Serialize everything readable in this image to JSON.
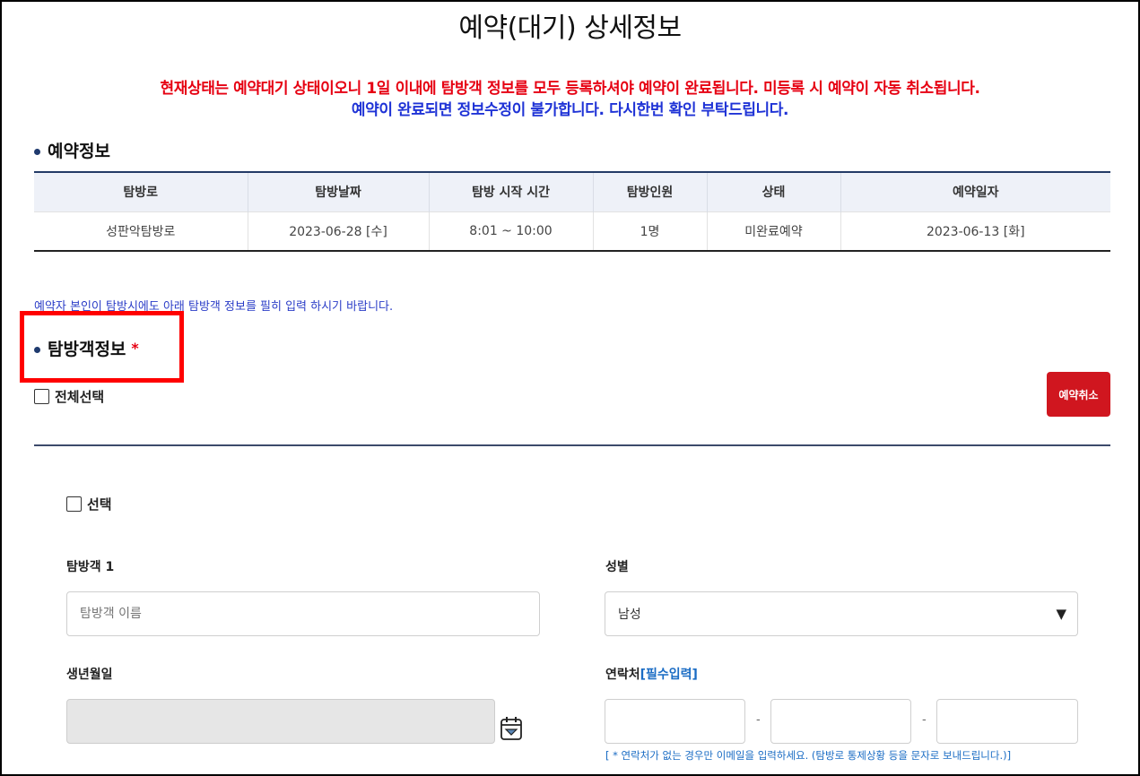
{
  "page": {
    "title": "예약(대기) 상세정보",
    "notice_red": "현재상태는 예약대기 상태이오니 1일 이내에 탐방객 정보를 모두 등록하셔야 예약이 완료됩니다. 미등록 시 예약이 자동 취소됩니다.",
    "notice_blue": "예약이 완료되면 정보수정이 불가합니다. 다시한번 확인 부탁드립니다."
  },
  "reservation": {
    "section_title": "예약정보",
    "headers": [
      "탐방로",
      "탐방날짜",
      "탐방 시작 시간",
      "탐방인원",
      "상태",
      "예약일자"
    ],
    "row": [
      "성판악탐방로",
      "2023-06-28 [수]",
      "8:01 ~ 10:00",
      "1명",
      "미완료예약",
      "2023-06-13 [화]"
    ]
  },
  "visitor": {
    "guide_text": "예약자 본인이 탐방시에도 아래 탐방객 정보를 필히 입력 하시기 바랍니다.",
    "section_title": "탐방객정보",
    "required_mark": "*",
    "select_all_label": "전체선택",
    "cancel_button": "예약취소",
    "select_label": "선택",
    "name_label": "탐방객 1",
    "name_placeholder": "탐방객 이름",
    "gender_label": "성별",
    "gender_value": "남성",
    "birth_label": "생년월일",
    "phone_label": "연락처",
    "phone_required": "[필수입력]",
    "phone_separator": "-",
    "phone_note": "[ * 연락처가 없는 경우만 이메일을 입력하세요. (탐방로 통제상황 등을 문자로 보내드립니다.)]"
  }
}
